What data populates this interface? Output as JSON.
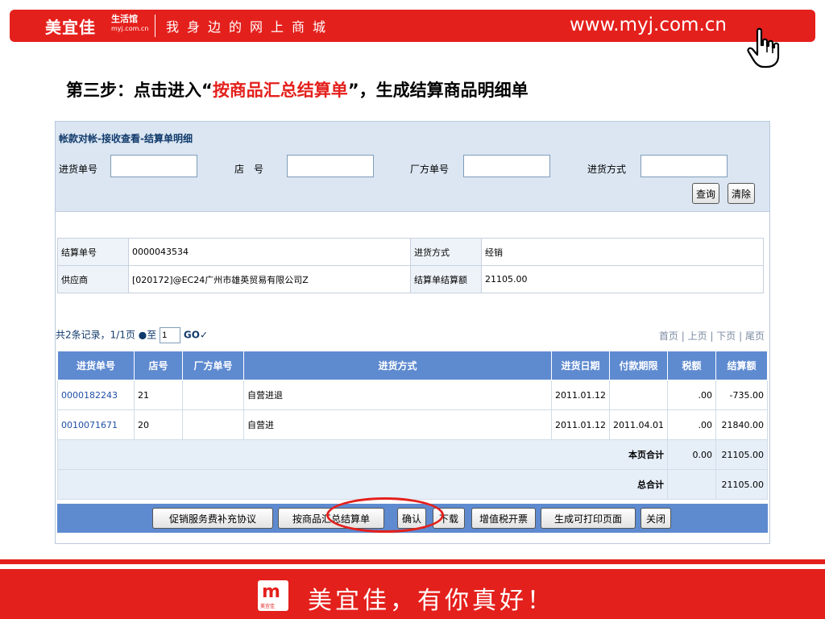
{
  "banner": {
    "brand": "美宜佳",
    "brand_sub1": "生活馆",
    "brand_sub2": "myj.com.cn",
    "slogan": "我身边的网上商城",
    "url": "www.myj.com.cn"
  },
  "step": {
    "prefix": "第三步：点击进入“",
    "highlight": "按商品汇总结算单",
    "suffix": "”，生成结算商品明细单"
  },
  "panel": {
    "title": "帐款对帐-接收查看-结算单明细",
    "search": {
      "order_label": "进货单号",
      "store_label": "店　号",
      "factory_label": "厂方单号",
      "method_label": "进货方式",
      "query_button": "查询",
      "clear_button": "清除"
    },
    "info": {
      "settle_no_label": "结算单号",
      "settle_no": "0000043534",
      "method_label": "进货方式",
      "method": "经销",
      "supplier_label": "供应商",
      "supplier": "[020172]@EC24广州市雄英贸易有限公司Z",
      "amount_label": "结算单结算额",
      "amount": "21105.00"
    },
    "pager": {
      "summary": "共2条记录，1/1页",
      "goto": "●至",
      "page_value": "1",
      "go": "GO✓",
      "first": "首页",
      "prev": "上页",
      "next": "下页",
      "last": "尾页"
    },
    "table": {
      "headers": [
        "进货单号",
        "店号",
        "厂方单号",
        "进货方式",
        "进货日期",
        "付款期限",
        "税额",
        "结算额"
      ],
      "rows": [
        {
          "order": "0000182243",
          "store": "21",
          "factory": "",
          "method": "自营进退",
          "date": "2011.01.12",
          "due": "",
          "tax": ".00",
          "amount": "-735.00"
        },
        {
          "order": "0010071671",
          "store": "20",
          "factory": "",
          "method": "自营进",
          "date": "2011.01.12",
          "due": "2011.04.01",
          "tax": ".00",
          "amount": "21840.00"
        }
      ],
      "page_total_label": "本页合计",
      "page_total_tax": "0.00",
      "page_total_amount": "21105.00",
      "grand_total_label": "总合计",
      "grand_total_amount": "21105.00"
    },
    "actions": {
      "promo": "促销服务费补充协议",
      "summary": "按商品汇总结算单",
      "confirm": "确认",
      "download": "下载",
      "invoice": "增值税开票",
      "printable": "生成可打印页面",
      "close": "关闭"
    }
  },
  "footer": {
    "logo_mark": "m",
    "logo_text": "美宜佳",
    "slogan": "美宜佳，有你真好！"
  },
  "colors": {
    "brand_red": "#e4201c",
    "header_blue": "#5e8ad0",
    "panel_bg": "#dbe6f2"
  }
}
